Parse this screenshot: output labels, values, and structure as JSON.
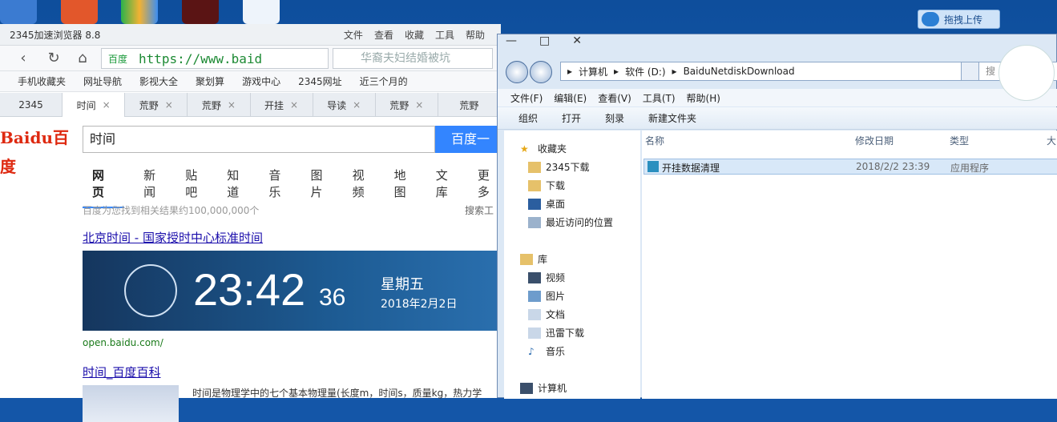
{
  "desktop": {
    "upload_label": "拖拽上传"
  },
  "browser": {
    "title": "2345加速浏览器 8.8",
    "menu": [
      "文件",
      "查看",
      "收藏",
      "工具",
      "帮助"
    ],
    "address_secure": "百度",
    "address_url": "https://www.baid",
    "search_placeholder": "华裔夫妇结婚被坑",
    "favorites": [
      "手机收藏夹",
      "网址导航",
      "影视大全",
      "聚划算",
      "游戏中心",
      "2345网址",
      "近三个月的"
    ],
    "tabs": [
      {
        "label": "2345",
        "active": false
      },
      {
        "label": "时间",
        "active": true
      },
      {
        "label": "荒野",
        "active": false
      },
      {
        "label": "荒野",
        "active": false
      },
      {
        "label": "开挂",
        "active": false
      },
      {
        "label": "导读",
        "active": false
      },
      {
        "label": "荒野",
        "active": false
      },
      {
        "label": "荒野",
        "active": false
      }
    ],
    "page": {
      "logo": "Baidu百度",
      "query": "时间",
      "search_button": "百度一下",
      "categories": [
        "网页",
        "新闻",
        "贴吧",
        "知道",
        "音乐",
        "图片",
        "视频",
        "地图",
        "文库",
        "更多"
      ],
      "result_count": "百度为您找到相关结果约100,000,000个",
      "filter": "搜索工",
      "result1": {
        "title": "北京时间 - 国家授时中心标准时间",
        "time": "23:42",
        "seconds": "36",
        "weekday": "星期五",
        "date": "2018年2月2日",
        "url": "open.baidu.com/"
      },
      "result2": {
        "title": "时间_百度百科",
        "snippet": "时间是物理学中的七个基本物理量(长度m，时间s，质量kg，热力学"
      }
    }
  },
  "explorer": {
    "path": [
      "计算机",
      "软件 (D:)",
      "BaiduNetdiskDownload"
    ],
    "search_placeholder": "搜",
    "menu": [
      "文件(F)",
      "编辑(E)",
      "查看(V)",
      "工具(T)",
      "帮助(H)"
    ],
    "commands": [
      "组织",
      "打开",
      "刻录",
      "新建文件夹"
    ],
    "sidebar": [
      {
        "label": "收藏夹",
        "icon": "star-icon"
      },
      {
        "label": "2345下载",
        "icon": "folder-icon"
      },
      {
        "label": "下载",
        "icon": "download-icon"
      },
      {
        "label": "桌面",
        "icon": "desktop-icon"
      },
      {
        "label": "最近访问的位置",
        "icon": "recent-icon"
      },
      {
        "label": "库",
        "icon": "library-icon"
      },
      {
        "label": "视频",
        "icon": "video-icon"
      },
      {
        "label": "图片",
        "icon": "picture-icon"
      },
      {
        "label": "文档",
        "icon": "document-icon"
      },
      {
        "label": "迅雷下载",
        "icon": "thunder-icon"
      },
      {
        "label": "音乐",
        "icon": "music-icon"
      },
      {
        "label": "计算机",
        "icon": "computer-icon"
      }
    ],
    "columns": [
      "名称",
      "修改日期",
      "类型",
      "大"
    ],
    "files": [
      {
        "name": "开挂数据清理",
        "date": "2018/2/2 23:39",
        "type": "应用程序"
      }
    ]
  }
}
